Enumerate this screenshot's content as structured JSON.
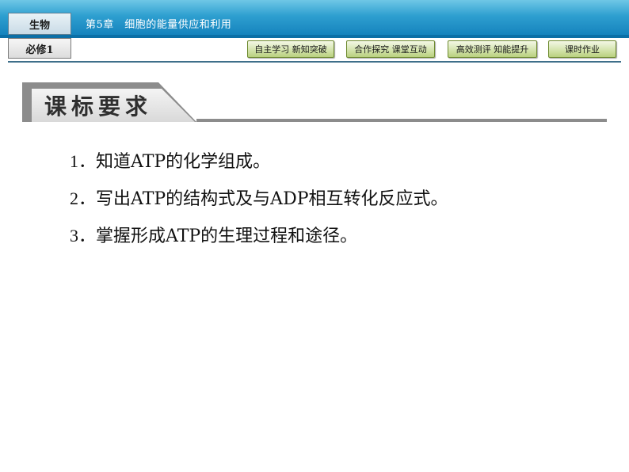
{
  "header": {
    "subject": "生物",
    "volume": "必修1",
    "chapter": "第5章　细胞的能量供应和利用"
  },
  "nav": [
    {
      "label": "自主学习  新知突破"
    },
    {
      "label": "合作探究  课堂互动"
    },
    {
      "label": "高效测评  知能提升"
    },
    {
      "label": "课时作业"
    }
  ],
  "section": {
    "title": "课标要求"
  },
  "requirements": [
    {
      "num": "1．",
      "text": "知道ATP的化学组成。"
    },
    {
      "num": "2．",
      "text": "写出ATP的结构式及与ADP相互转化反应式。"
    },
    {
      "num": "3．",
      "text": "掌握形成ATP的生理过程和途径。"
    }
  ],
  "colors": {
    "header_blue": "#1583bd",
    "nav_green": "#b9d17f",
    "section_gray": "#8c8c8c"
  }
}
